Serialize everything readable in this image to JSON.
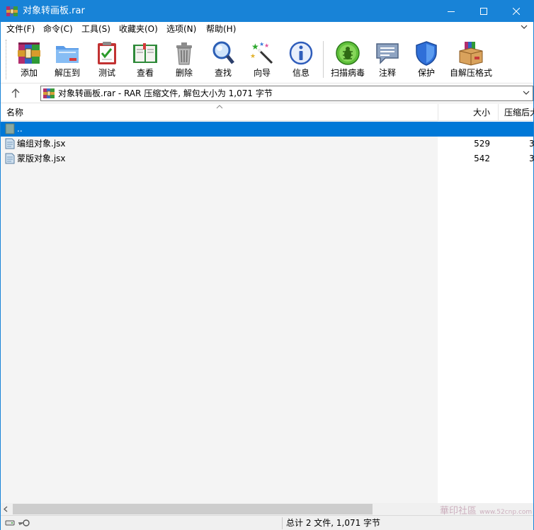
{
  "window": {
    "title": "对象转画板.rar"
  },
  "menu": [
    {
      "label": "文件(F)"
    },
    {
      "label": "命令(C)"
    },
    {
      "label": "工具(S)"
    },
    {
      "label": "收藏夹(O)"
    },
    {
      "label": "选项(N)"
    },
    {
      "label": "帮助(H)"
    }
  ],
  "toolbar": [
    {
      "label": "添加",
      "icon": "add-archive-icon"
    },
    {
      "label": "解压到",
      "icon": "extract-folder-icon"
    },
    {
      "label": "测试",
      "icon": "test-clipboard-icon"
    },
    {
      "label": "查看",
      "icon": "view-book-icon"
    },
    {
      "label": "删除",
      "icon": "trash-icon"
    },
    {
      "label": "查找",
      "icon": "magnifier-icon"
    },
    {
      "label": "向导",
      "icon": "wizard-wand-icon"
    },
    {
      "label": "信息",
      "icon": "info-icon"
    },
    {
      "label": "扫描病毒",
      "icon": "virus-scan-icon"
    },
    {
      "label": "注释",
      "icon": "comment-icon"
    },
    {
      "label": "保护",
      "icon": "shield-icon"
    },
    {
      "label": "自解压格式",
      "icon": "sfx-box-icon"
    }
  ],
  "address": {
    "path": "对象转画板.rar - RAR 压缩文件, 解包大小为 1,071 字节"
  },
  "columns": {
    "name": "名称",
    "size": "大小",
    "packed": "压缩后大"
  },
  "files": [
    {
      "name": "..",
      "size": "",
      "packed": "",
      "selected": true,
      "icon": "parent-folder-icon"
    },
    {
      "name": "编组对象.jsx",
      "size": "529",
      "packed": "3",
      "selected": false,
      "icon": "jsx-file-icon"
    },
    {
      "name": "蒙版对象.jsx",
      "size": "542",
      "packed": "3",
      "selected": false,
      "icon": "jsx-file-icon"
    }
  ],
  "status": {
    "text": "总计 2 文件, 1,071 字节"
  },
  "watermark": {
    "text": "華印社區",
    "url_text": "www.52cnp.com"
  },
  "colors": {
    "titlebar": "#1883d7",
    "selection": "#0078d7"
  }
}
